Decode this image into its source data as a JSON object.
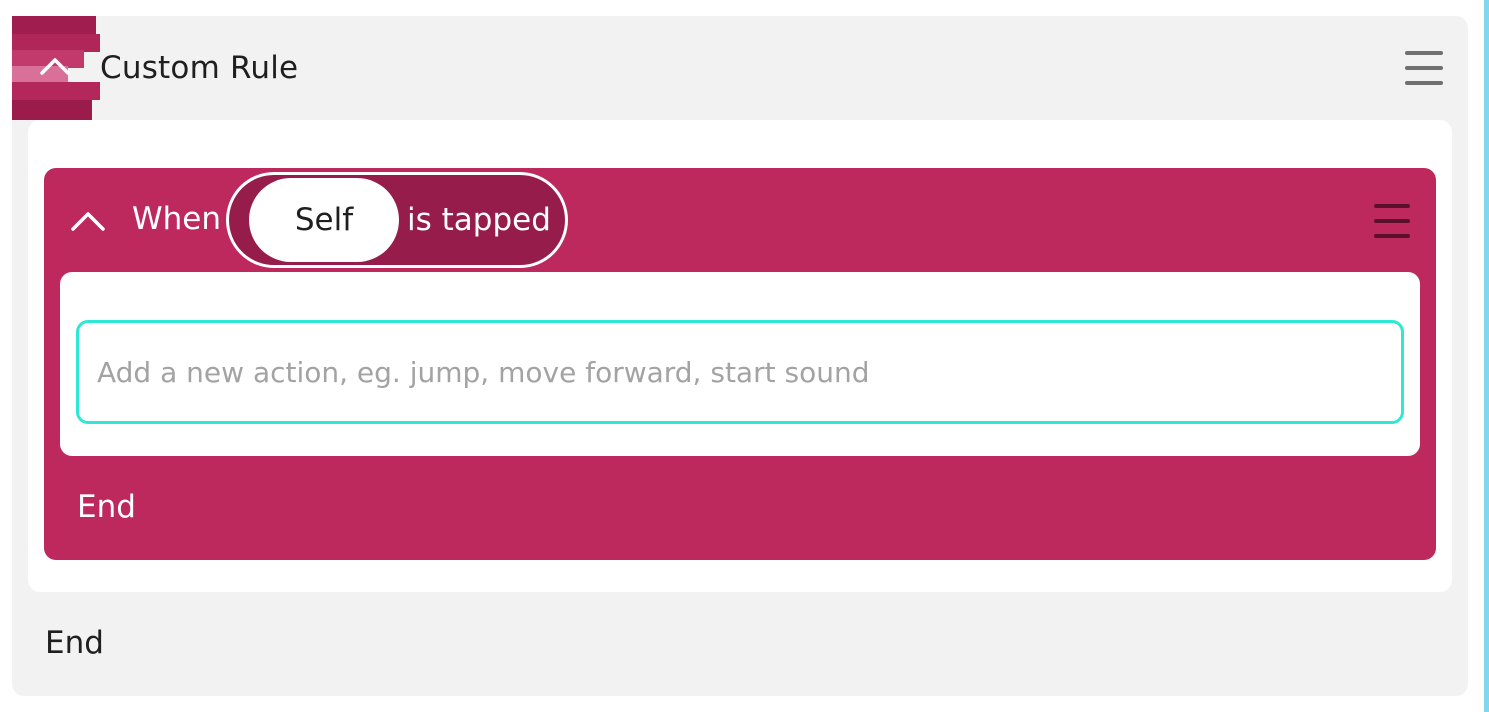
{
  "rule": {
    "title": "Custom Rule",
    "end_label": "End",
    "menu_icon": "hamburger-menu-icon",
    "collapse_icon": "chevron-up-icon",
    "icon_colors": [
      "#a01e4f",
      "#b02658",
      "#c23a6c",
      "#d9709a",
      "#b3275a",
      "#9b1c4b"
    ]
  },
  "trigger": {
    "when_label": "When",
    "subject": "Self",
    "event": "is tapped",
    "end_label": "End",
    "menu_icon": "hamburger-menu-icon",
    "collapse_icon": "chevron-up-icon",
    "color": "#bd285d",
    "pill_color": "#961d4b"
  },
  "action_input": {
    "value": "",
    "placeholder": "Add a new action, eg. jump, move forward, start sound",
    "focus_color": "#2ee8d6"
  }
}
